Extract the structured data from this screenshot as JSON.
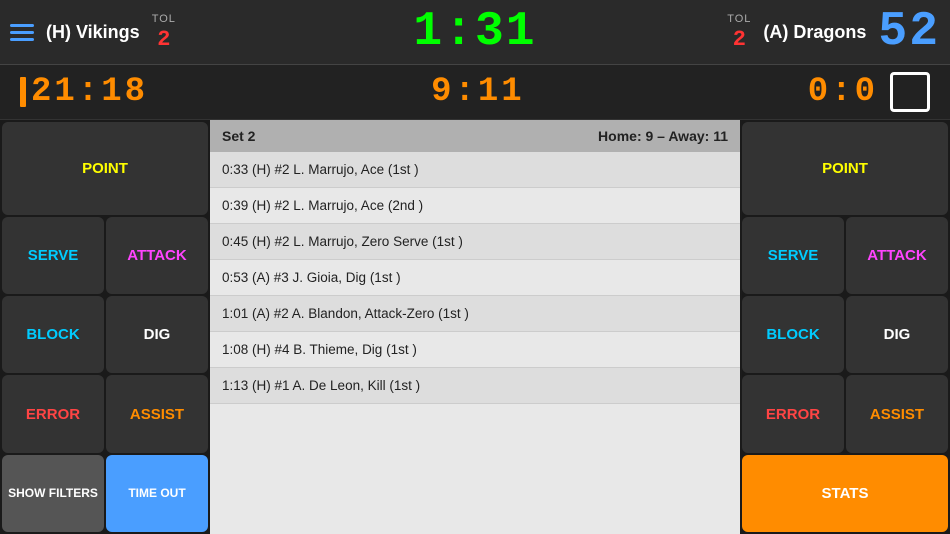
{
  "header": {
    "home_team": "(H) Vikings",
    "away_team": "(A) Dragons",
    "tol_label": "TOL",
    "tol_home": "2",
    "tol_away": "2",
    "main_score": "1:31",
    "away_score": "52",
    "hamburger_label": "menu"
  },
  "sub_header": {
    "home_score": "21:18",
    "center_score": "9:11",
    "away_score": "0:0"
  },
  "left_panel": {
    "point_label": "POINT",
    "serve_label": "SERVE",
    "attack_label": "ATTACK",
    "block_label": "BLOCK",
    "dig_label": "DIG",
    "error_label": "ERROR",
    "assist_label": "ASSIST",
    "show_filters_label": "SHOW FILTERS",
    "timeout_label": "TIME OUT"
  },
  "right_panel": {
    "point_label": "POINT",
    "serve_label": "SERVE",
    "attack_label": "ATTACK",
    "block_label": "BLOCK",
    "dig_label": "DIG",
    "error_label": "ERROR",
    "assist_label": "ASSIST",
    "stats_label": "STATS"
  },
  "log": {
    "set_label": "Set 2",
    "score_summary": "Home: 9 – Away: 11",
    "entries": [
      "0:33 (H) #2 L. Marrujo, Ace (1st )",
      "0:39 (H) #2 L. Marrujo, Ace (2nd )",
      "0:45 (H) #2 L. Marrujo, Zero Serve (1st )",
      "0:53 (A) #3 J. Gioia, Dig (1st )",
      "1:01 (A) #2 A. Blandon, Attack-Zero (1st )",
      "1:08 (H) #4 B. Thieme, Dig (1st )",
      "1:13 (H) #1 A. De Leon, Kill (1st )"
    ]
  }
}
